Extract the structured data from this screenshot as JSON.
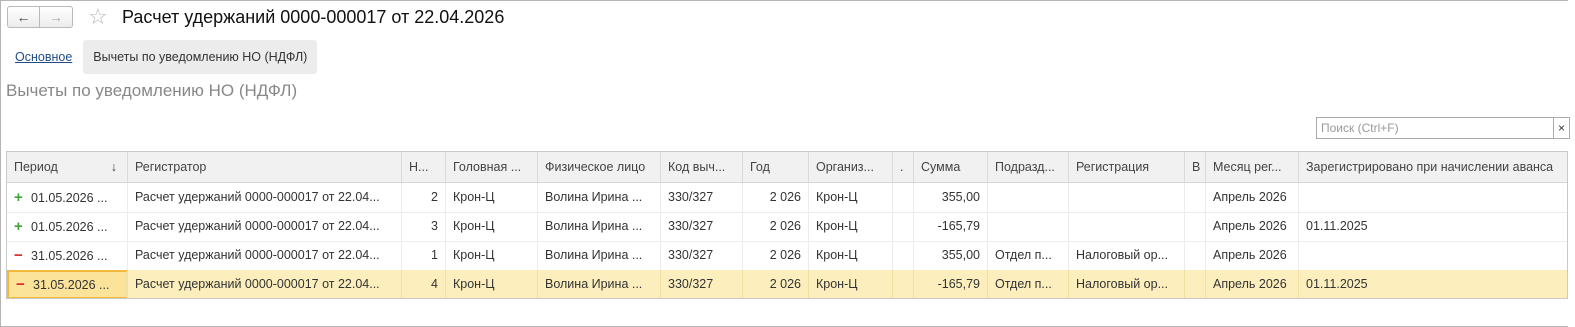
{
  "window": {
    "title": "Расчет удержаний 0000-000017 от 22.04.2026"
  },
  "nav": {
    "back_icon": "←",
    "forward_icon": "→",
    "star_icon": "☆"
  },
  "tabs": [
    {
      "label": "Основное",
      "active": false
    },
    {
      "label": "Вычеты по уведомлению НО (НДФЛ)",
      "active": true
    }
  ],
  "section": {
    "title": "Вычеты по уведомлению НО (НДФЛ)"
  },
  "search": {
    "placeholder": "Поиск (Ctrl+F)",
    "clear": "×"
  },
  "table": {
    "columns": [
      "Период",
      "Регистратор",
      "Н...",
      "Головная ...",
      "Физическое лицо",
      "Код выч...",
      "Год",
      "Организ...",
      ".",
      "Сумма",
      "Подразд...",
      "Регистрация",
      "В",
      "Месяц рег...",
      "Зарегистрировано при начислении аванса"
    ],
    "sort_icon": "↓",
    "rows": [
      {
        "sign": "+",
        "period": "01.05.2026 ...",
        "registrator": "Расчет удержаний 0000-000017 от 22.04...",
        "n": "2",
        "head": "Крон-Ц",
        "person": "Волина Ирина ...",
        "code": "330/327",
        "year": "2 026",
        "org": "Крон-Ц",
        "dot": "",
        "sum": "355,00",
        "dept": "",
        "reg": "",
        "v": "",
        "month": "Апрель 2026",
        "advance": ""
      },
      {
        "sign": "+",
        "period": "01.05.2026 ...",
        "registrator": "Расчет удержаний 0000-000017 от 22.04...",
        "n": "3",
        "head": "Крон-Ц",
        "person": "Волина Ирина ...",
        "code": "330/327",
        "year": "2 026",
        "org": "Крон-Ц",
        "dot": "",
        "sum": "-165,79",
        "dept": "",
        "reg": "",
        "v": "",
        "month": "Апрель 2026",
        "advance": "01.11.2025"
      },
      {
        "sign": "−",
        "period": "31.05.2026 ...",
        "registrator": "Расчет удержаний 0000-000017 от 22.04...",
        "n": "1",
        "head": "Крон-Ц",
        "person": "Волина Ирина ...",
        "code": "330/327",
        "year": "2 026",
        "org": "Крон-Ц",
        "dot": "",
        "sum": "355,00",
        "dept": "Отдел п...",
        "reg": "Налоговый ор...",
        "v": "",
        "month": "Апрель 2026",
        "advance": ""
      },
      {
        "sign": "−",
        "period": "31.05.2026 ...",
        "registrator": "Расчет удержаний 0000-000017 от 22.04...",
        "n": "4",
        "head": "Крон-Ц",
        "person": "Волина Ирина ...",
        "code": "330/327",
        "year": "2 026",
        "org": "Крон-Ц",
        "dot": "",
        "sum": "-165,79",
        "dept": "Отдел п...",
        "reg": "Налоговый ор...",
        "v": "",
        "month": "Апрель 2026",
        "advance": "01.11.2025",
        "selected": true
      }
    ]
  }
}
